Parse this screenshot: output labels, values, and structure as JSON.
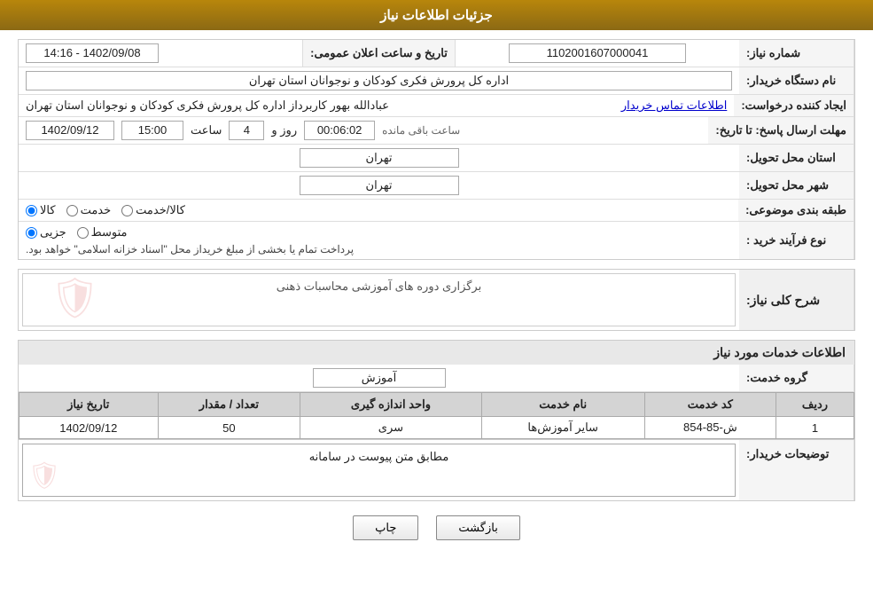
{
  "header": {
    "title": "جزئیات اطلاعات نیاز"
  },
  "fields": {
    "need_number_label": "شماره نیاز:",
    "need_number_value": "1102001607000041",
    "announce_datetime_label": "تاریخ و ساعت اعلان عمومی:",
    "announce_datetime_value": "1402/09/08 - 14:16",
    "buyer_org_label": "نام دستگاه خریدار:",
    "buyer_org_value": "اداره کل پرورش فکری کودکان و نوجوانان استان تهران",
    "creator_label": "ایجاد کننده درخواست:",
    "creator_value": "عبادالله بهور کاربرداز اداره کل پرورش فکری کودکان و نوجوانان استان تهران",
    "contact_link": "اطلاعات تماس خریدار",
    "reply_deadline_label": "مهلت ارسال پاسخ: تا تاریخ:",
    "reply_date": "1402/09/12",
    "reply_time_label": "ساعت",
    "reply_time": "15:00",
    "reply_days_label": "روز و",
    "reply_days": "4",
    "reply_remaining_label": "ساعت باقی مانده",
    "reply_remaining": "00:06:02",
    "province_label": "استان محل تحویل:",
    "province_value": "تهران",
    "city_label": "شهر محل تحویل:",
    "city_value": "تهران",
    "category_label": "طبقه بندی موضوعی:",
    "radio_kala": "کالا",
    "radio_khedmat": "خدمت",
    "radio_kala_khedmat": "کالا/خدمت",
    "purchase_type_label": "نوع فرآیند خرید :",
    "radio_jozii": "جزیی",
    "radio_motevaset": "متوسط",
    "purchase_note": "پرداخت تمام یا بخشی از مبلغ خریداز محل \"اسناد خزانه اسلامی\" خواهد بود.",
    "general_description_label": "شرح کلی نیاز:",
    "general_description_value": "برگزاری دوره های آموزشی محاسبات ذهنی",
    "service_info_title": "اطلاعات خدمات مورد نیاز",
    "service_group_label": "گروه خدمت:",
    "service_group_value": "آموزش",
    "table": {
      "col_row": "ردیف",
      "col_code": "کد خدمت",
      "col_name": "نام خدمت",
      "col_unit": "واحد اندازه گیری",
      "col_qty": "تعداد / مقدار",
      "col_date": "تاریخ نیاز",
      "rows": [
        {
          "row": "1",
          "code": "ش-85-854",
          "name": "سایر آموزش‌ها",
          "unit": "سری",
          "qty": "50",
          "date": "1402/09/12"
        }
      ]
    },
    "buyer_notes_label": "توضیحات خریدار:",
    "buyer_notes_value": "مطابق متن پیوست در سامانه"
  },
  "buttons": {
    "print": "چاپ",
    "back": "بازگشت"
  }
}
